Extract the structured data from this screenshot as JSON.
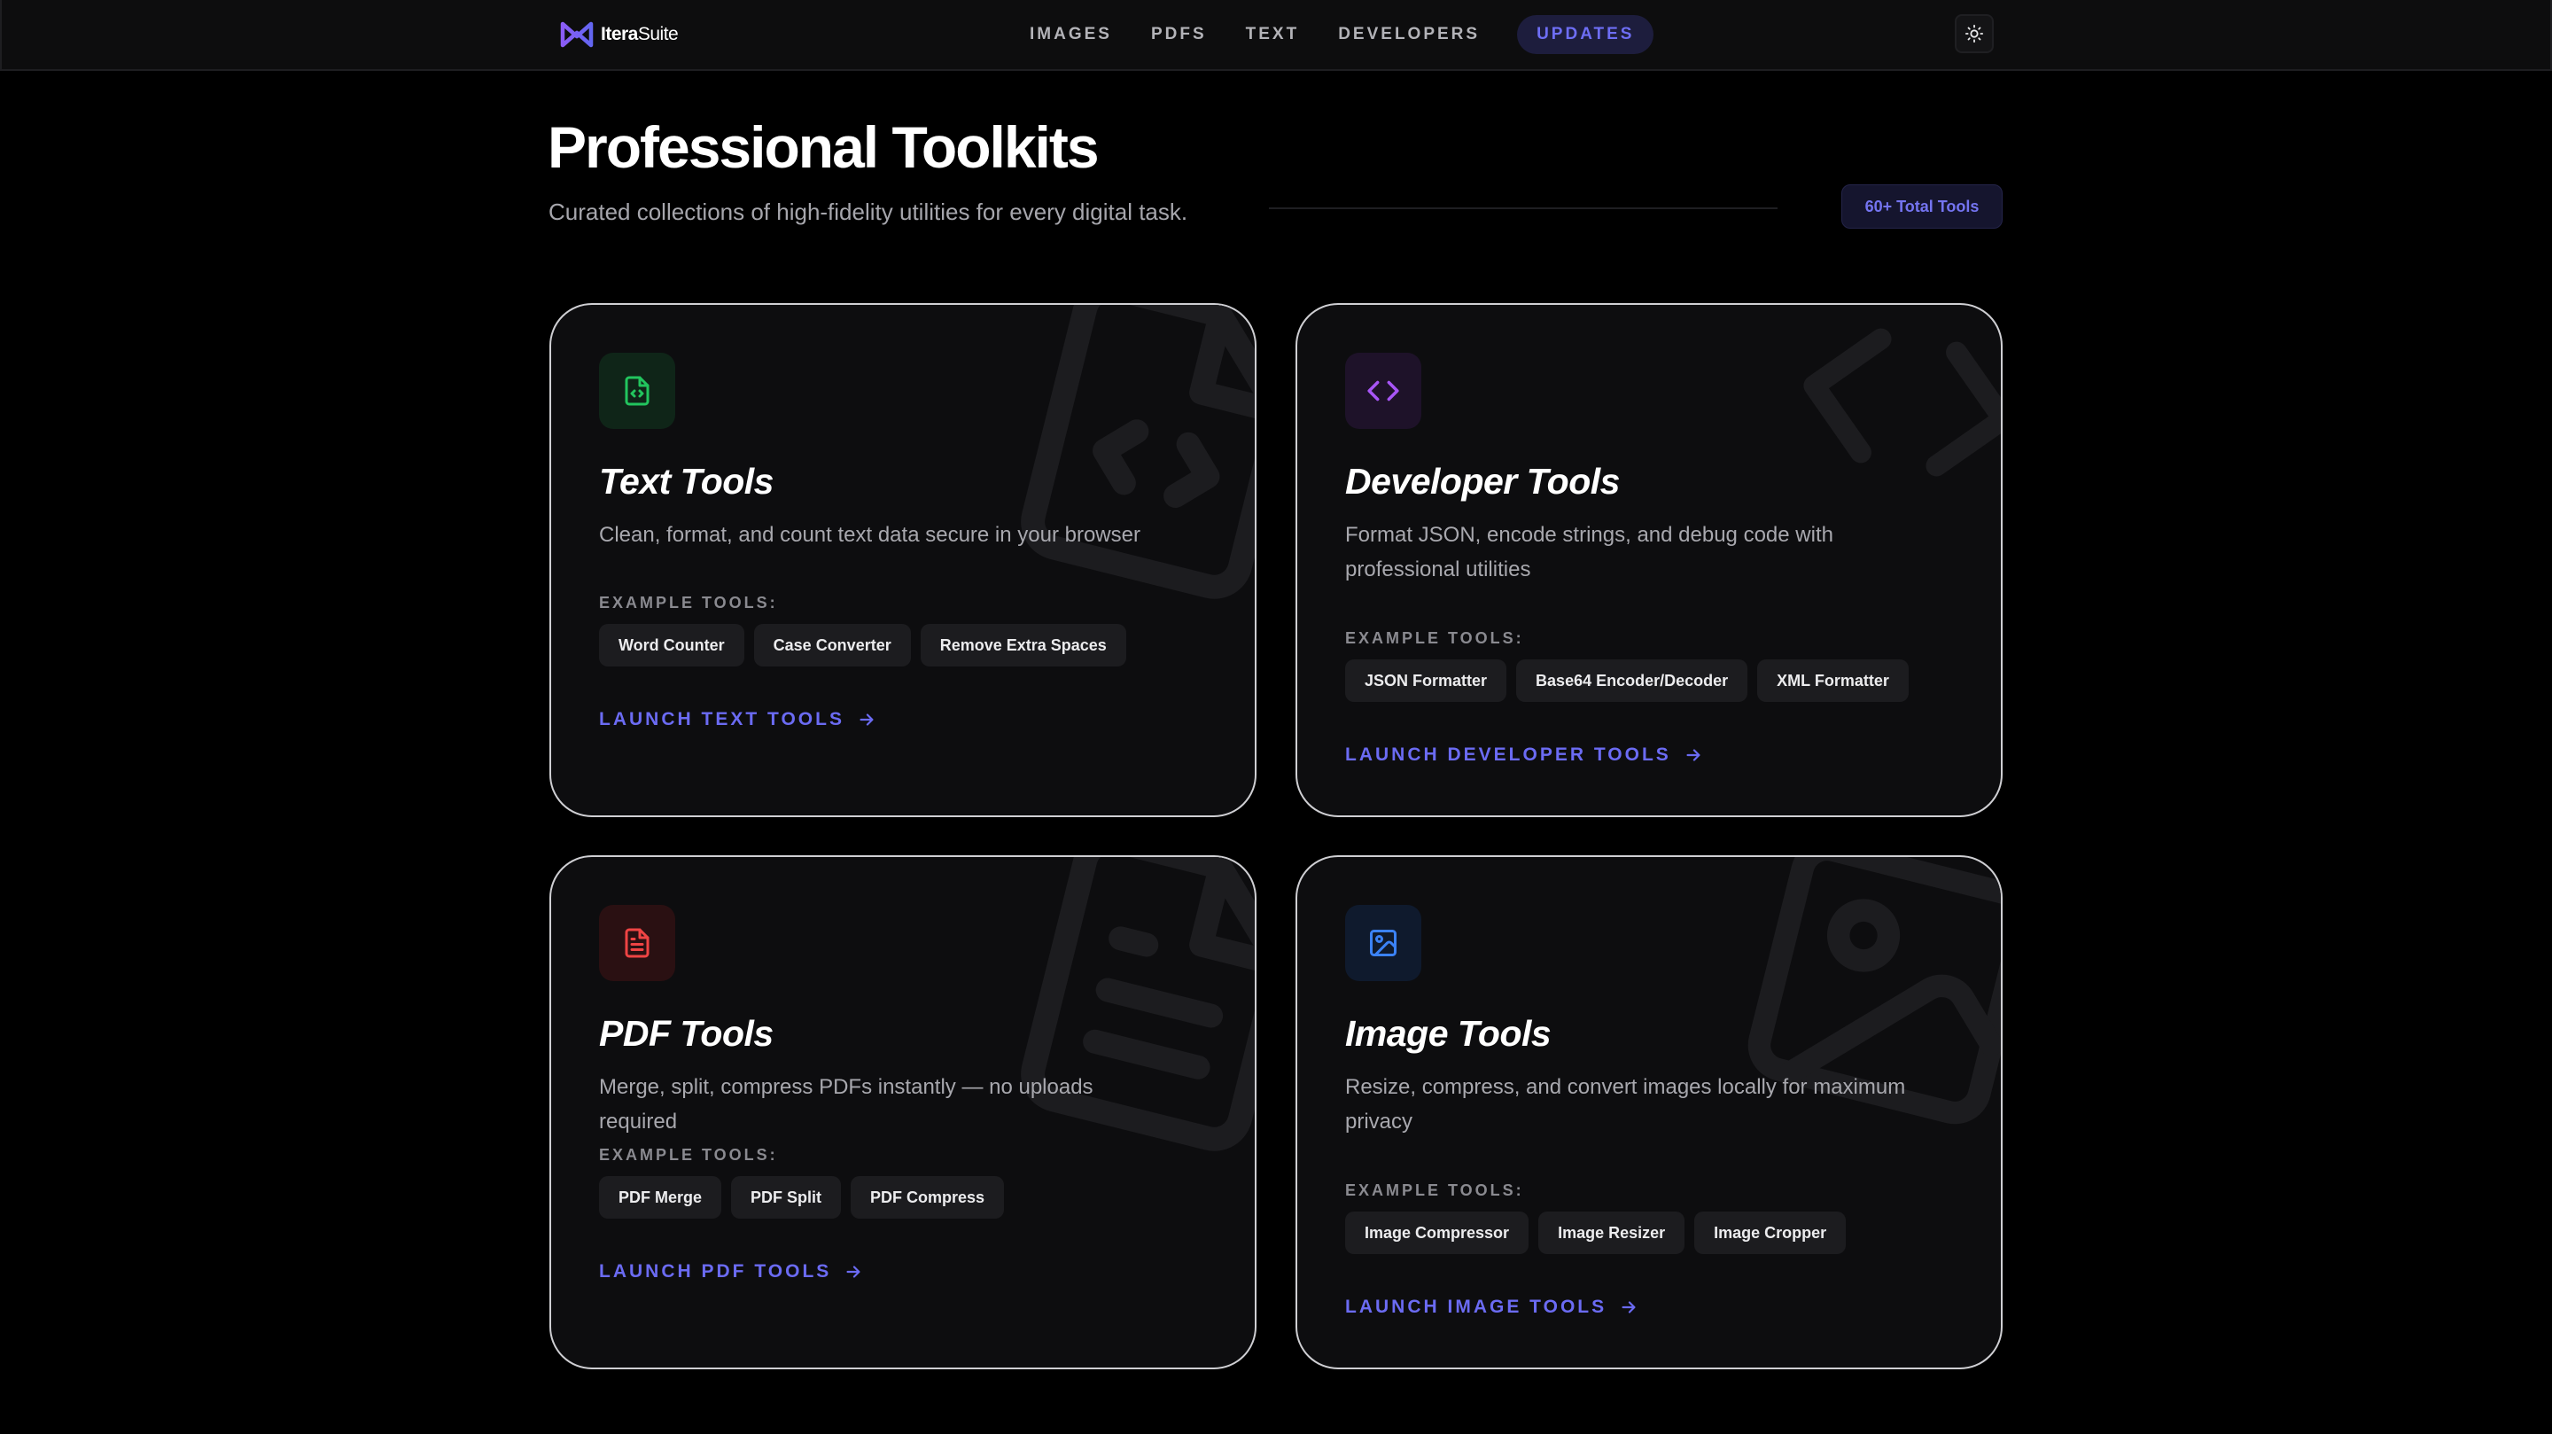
{
  "nav": {
    "logo_bold": "Itera",
    "logo_rest": "Suite",
    "links": [
      "IMAGES",
      "PDFS",
      "TEXT",
      "DEVELOPERS"
    ],
    "updates": "UPDATES",
    "theme_icon": "sun-icon"
  },
  "header": {
    "title": "Professional Toolkits",
    "subtitle": "Curated collections of high-fidelity utilities for every digital task.",
    "badge": "60+ Total Tools"
  },
  "example_label": "EXAMPLE TOOLS:",
  "cards": [
    {
      "title": "Text Tools",
      "desc": "Clean, format, and count text data secure in your browser",
      "chips": [
        "Word Counter",
        "Case Converter",
        "Remove Extra Spaces"
      ],
      "launch": "LAUNCH TEXT TOOLS",
      "icon": "file-code-icon",
      "accent": "#22c55e"
    },
    {
      "title": "Developer Tools",
      "desc": "Format JSON, encode strings, and debug code with professional utilities",
      "chips": [
        "JSON Formatter",
        "Base64 Encoder/Decoder",
        "XML Formatter"
      ],
      "launch": "LAUNCH DEVELOPER TOOLS",
      "icon": "code-icon",
      "accent": "#a855f7"
    },
    {
      "title": "PDF Tools",
      "desc": "Merge, split, compress PDFs instantly — no uploads required",
      "chips": [
        "PDF Merge",
        "PDF Split",
        "PDF Compress"
      ],
      "launch": "LAUNCH PDF TOOLS",
      "icon": "file-text-icon",
      "accent": "#ef4444"
    },
    {
      "title": "Image Tools",
      "desc": "Resize, compress, and convert images locally for maximum privacy",
      "chips": [
        "Image Compressor",
        "Image Resizer",
        "Image Cropper"
      ],
      "launch": "LAUNCH IMAGE TOOLS",
      "icon": "image-icon",
      "accent": "#3b82f6"
    }
  ],
  "colors": {
    "background": "#000000",
    "accent": "#6b6bf3"
  }
}
